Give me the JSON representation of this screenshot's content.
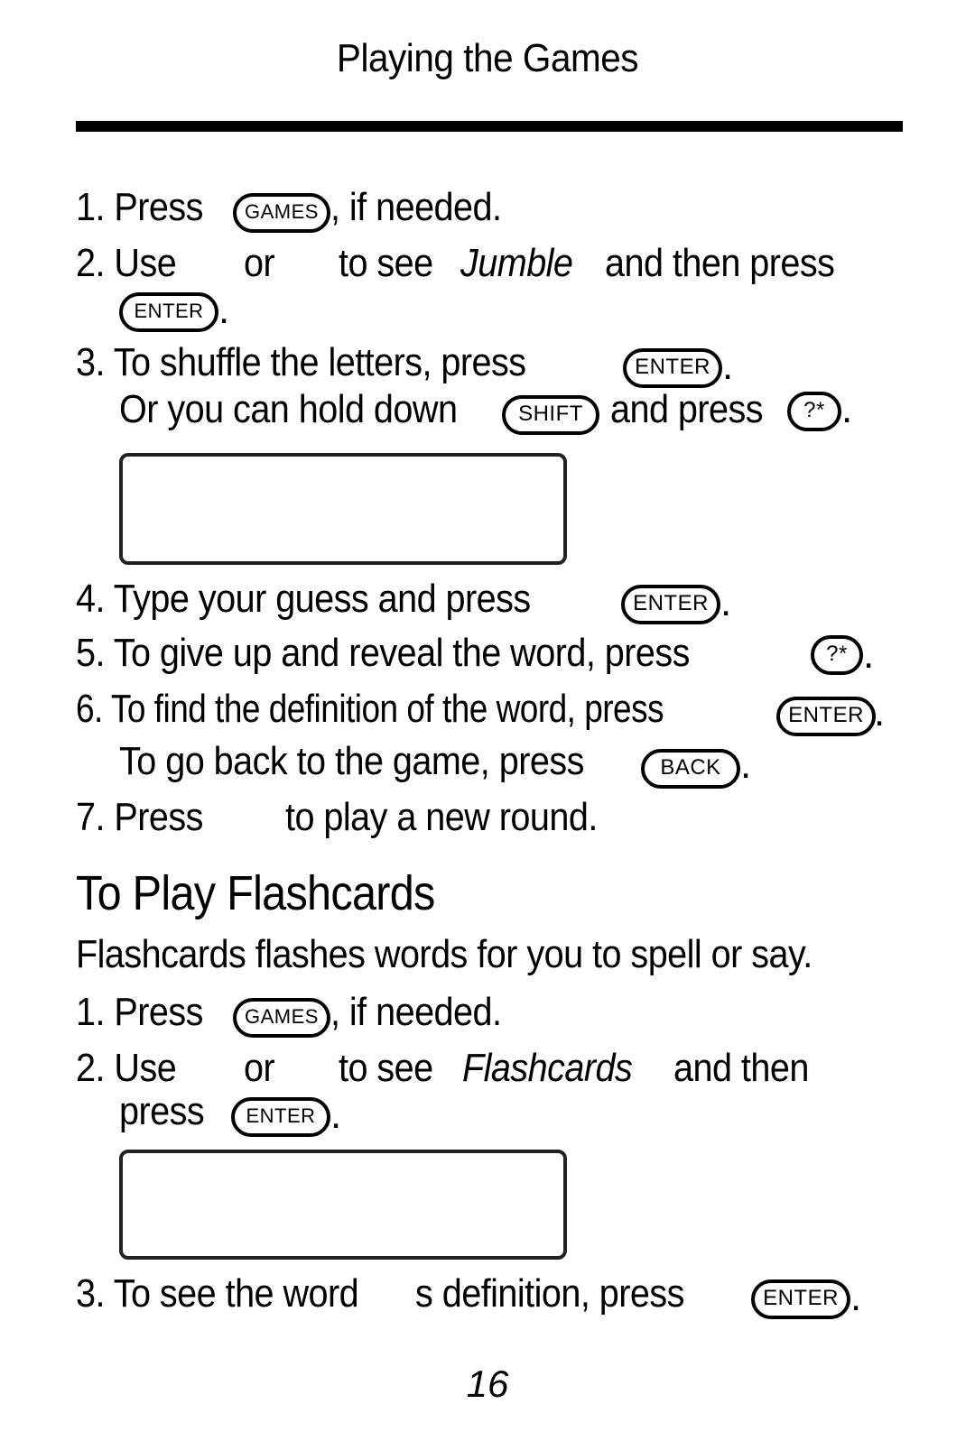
{
  "running_head": "Playing the Games",
  "jumble_steps": [
    {
      "num": "1.",
      "pre": "Press",
      "key": "GAMES",
      "post": ", if needed."
    },
    {
      "num": "2.",
      "pre": "Use",
      "mid1": "or",
      "mid2": "to see",
      "game": "Jumble",
      "post": "and then press",
      "key": "ENTER",
      "end": "."
    },
    {
      "num": "3.",
      "pre": "To shuffle the letters, press",
      "key": "ENTER",
      "end": ".",
      "line2_pre": "Or you can hold down",
      "line2_key1": "SHIFT",
      "line2_mid": "and press",
      "line2_key2": "?*",
      "line2_end": "."
    },
    {
      "num": "4.",
      "pre": "Type your guess and press",
      "key": "ENTER",
      "end": "."
    },
    {
      "num": "5.",
      "pre": "To give up and reveal the word, press",
      "key": "?*",
      "end": "."
    },
    {
      "num": "6.",
      "pre": "To find the definition of the word, press",
      "key": "ENTER",
      "end": ".",
      "line2_pre": "To go back to the game, press",
      "line2_key": "BACK",
      "line2_end": "."
    },
    {
      "num": "7.",
      "pre": "Press",
      "post": "to play a new round."
    }
  ],
  "flashcards": {
    "heading": "To Play Flashcards",
    "intro": "Flashcards flashes words for you to spell or say.",
    "steps": [
      {
        "num": "1.",
        "pre": "Press",
        "key": "GAMES",
        "post": ", if needed."
      },
      {
        "num": "2.",
        "pre": "Use",
        "mid1": "or",
        "mid2": "to see",
        "game": "Flashcards",
        "post": "and then",
        "line2_pre": "press",
        "key": "ENTER",
        "end": "."
      },
      {
        "num": "3.",
        "pre": "To see the word",
        "mid": "s definition, press",
        "key": "ENTER",
        "end": "."
      }
    ]
  },
  "page_number": "16"
}
